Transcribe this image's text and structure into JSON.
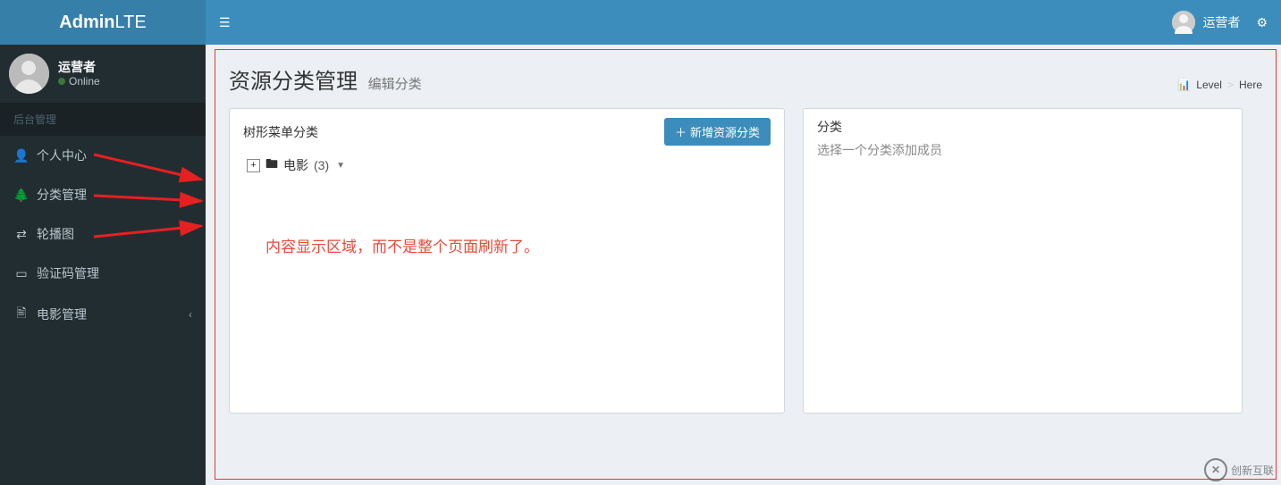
{
  "brand": {
    "bold": "Admin",
    "light": "LTE"
  },
  "user": {
    "name": "运营者",
    "status_label": "Online"
  },
  "sidebar": {
    "section_header": "后台管理",
    "items": [
      {
        "icon": "user",
        "label": "个人中心",
        "has_sub": false
      },
      {
        "icon": "tree",
        "label": "分类管理",
        "has_sub": false
      },
      {
        "icon": "exchange",
        "label": "轮播图",
        "has_sub": false
      },
      {
        "icon": "idcard",
        "label": "验证码管理",
        "has_sub": false
      },
      {
        "icon": "file",
        "label": "电影管理",
        "has_sub": true
      }
    ]
  },
  "navbar": {
    "user_label": "运营者"
  },
  "header": {
    "title": "资源分类管理",
    "subtitle": "编辑分类",
    "breadcrumb": {
      "level": "Level",
      "here": "Here"
    }
  },
  "panel_left": {
    "title": "树形菜单分类",
    "add_button": "新增资源分类",
    "tree_root_label": "电影",
    "tree_root_count": "(3)"
  },
  "panel_right": {
    "title": "分类",
    "hint": "选择一个分类添加成员"
  },
  "annotation": {
    "note": "内容显示区域，而不是整个页面刷新了。"
  },
  "watermark": {
    "text": "创新互联"
  }
}
